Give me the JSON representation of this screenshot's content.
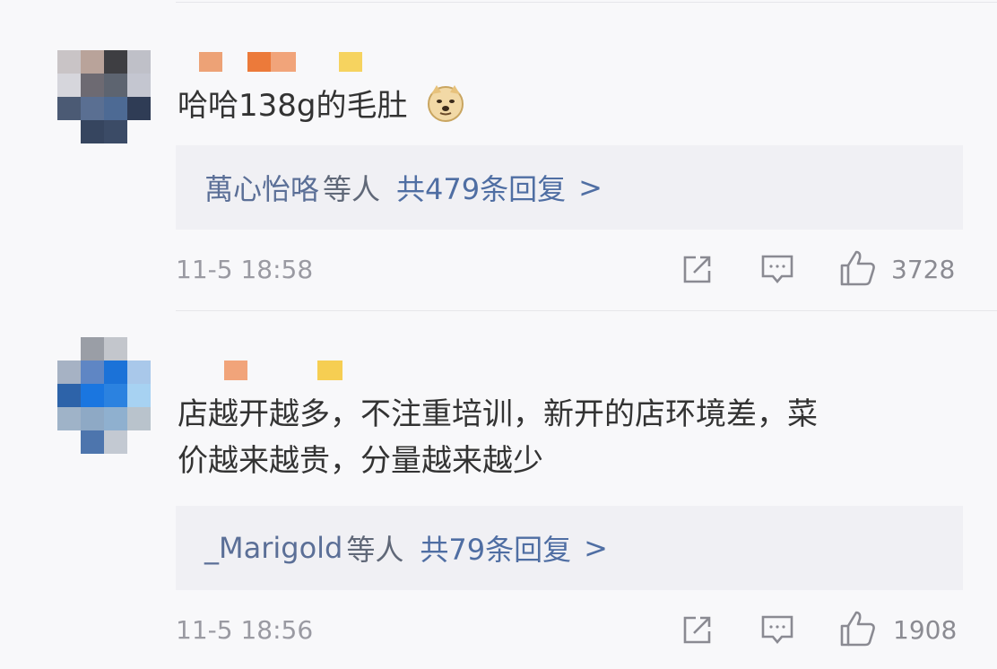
{
  "comments": [
    {
      "text_lines": [
        "哈哈138g的毛肚"
      ],
      "emoji_icon": "doge-icon",
      "replies_names": "萬心怡咯",
      "replies_mid": "等人",
      "replies_count": "共479条回复",
      "replies_chevron": ">",
      "timestamp": "11-5 18:58",
      "like_count": "3728"
    },
    {
      "text_lines": [
        "店越开越多，不注重培训，新开的店环境差，菜",
        "价越来越贵，分量越来越少"
      ],
      "replies_names": "_Marigold",
      "replies_mid": "等人",
      "replies_count": "共79条回复",
      "replies_chevron": ">",
      "timestamp": "11-5 18:56",
      "like_count": "1908"
    }
  ],
  "icons": {
    "share": "share-icon",
    "comment": "comment-icon",
    "like": "thumbs-up-icon"
  },
  "colors": {
    "reply_link": "#4f6ea3",
    "reply_box_bg": "#f0f0f4",
    "background": "#f8f8fa"
  }
}
